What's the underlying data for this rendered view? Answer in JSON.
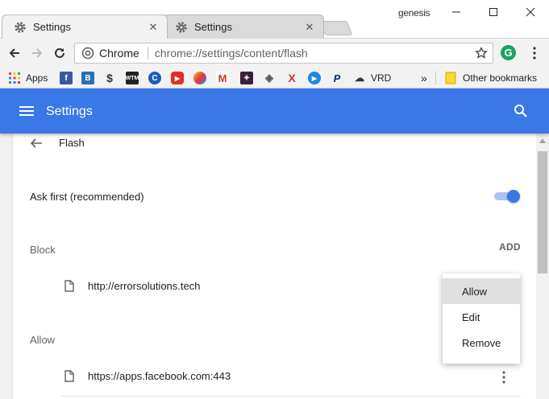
{
  "window": {
    "profile_name": "genesis",
    "controls": [
      "minimize",
      "maximize",
      "close"
    ]
  },
  "tabs": [
    {
      "title": "Settings",
      "active": true
    },
    {
      "title": "Settings",
      "active": false
    }
  ],
  "toolbar": {
    "origin": "Chrome",
    "url": "chrome://settings/content/flash",
    "extension_letter": "G"
  },
  "bookmarks": {
    "apps_label": "Apps",
    "vrd_label": "VRD",
    "other_label": "Other bookmarks",
    "more_label": "»"
  },
  "header": {
    "title": "Settings"
  },
  "page": {
    "title": "Flash",
    "ask_first_label": "Ask first (recommended)",
    "ask_first_enabled": true,
    "block_label": "Block",
    "add_label": "ADD",
    "allow_label": "Allow",
    "blocked_sites": [
      "http://errorsolutions.tech"
    ],
    "allowed_sites": [
      "https://apps.facebook.com:443"
    ]
  },
  "context_menu": {
    "items": [
      "Allow",
      "Edit",
      "Remove"
    ],
    "highlighted": "Allow"
  },
  "colors": {
    "accent": "#3b78e7",
    "toggle_track": "#a9c4f5"
  }
}
